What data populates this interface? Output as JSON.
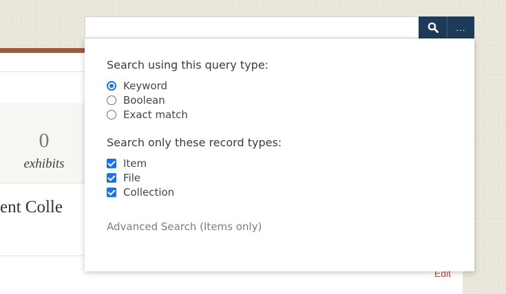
{
  "search": {
    "value": "",
    "placeholder": "",
    "search_icon": "search-icon",
    "options_label": "..."
  },
  "filters": {
    "query_type_heading": "Search using this query type:",
    "query_types": [
      {
        "label": "Keyword",
        "checked": true
      },
      {
        "label": "Boolean",
        "checked": false
      },
      {
        "label": "Exact match",
        "checked": false
      }
    ],
    "record_types_heading": "Search only these record types:",
    "record_types": [
      {
        "label": "Item",
        "checked": true
      },
      {
        "label": "File",
        "checked": true
      },
      {
        "label": "Collection",
        "checked": true
      }
    ],
    "advanced_link": "Advanced Search (Items only)"
  },
  "background": {
    "stat_count": "0",
    "stat_label": "exhibits",
    "collection_title": "ent Colle",
    "edit_link": "Edit"
  },
  "colors": {
    "accent": "#9a5a3c",
    "button": "#1d3b56",
    "check": "#1a73e8",
    "link": "#8a7a73"
  }
}
